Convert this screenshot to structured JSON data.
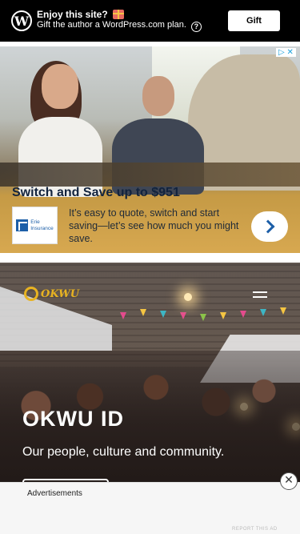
{
  "wp_banner": {
    "title": "Enjoy this site?",
    "subtitle": "Gift the author a WordPress.com plan.",
    "gift_label": "Gift",
    "logo_letter": "W",
    "help_symbol": "?"
  },
  "ad": {
    "ad_choice": "▷ ✕",
    "headline": "Switch and Save up to $951",
    "advertiser_line1": "Erie",
    "advertiser_line2": "Insurance",
    "body": "It’s easy to quote, switch and start saving—let’s see how much you might save.",
    "cta_icon": "chevron-right-icon"
  },
  "hero": {
    "logo_text": "OKWU",
    "title": "OKWU ID",
    "subtitle": "Our people, culture and community."
  },
  "bottom_ad": {
    "label": "Advertisements",
    "report": "REPORT THIS AD",
    "close_symbol": "✕"
  },
  "colors": {
    "banner_bg": "#000000",
    "okwu_gold": "#e8b321",
    "erie_blue": "#1d5fa8"
  }
}
